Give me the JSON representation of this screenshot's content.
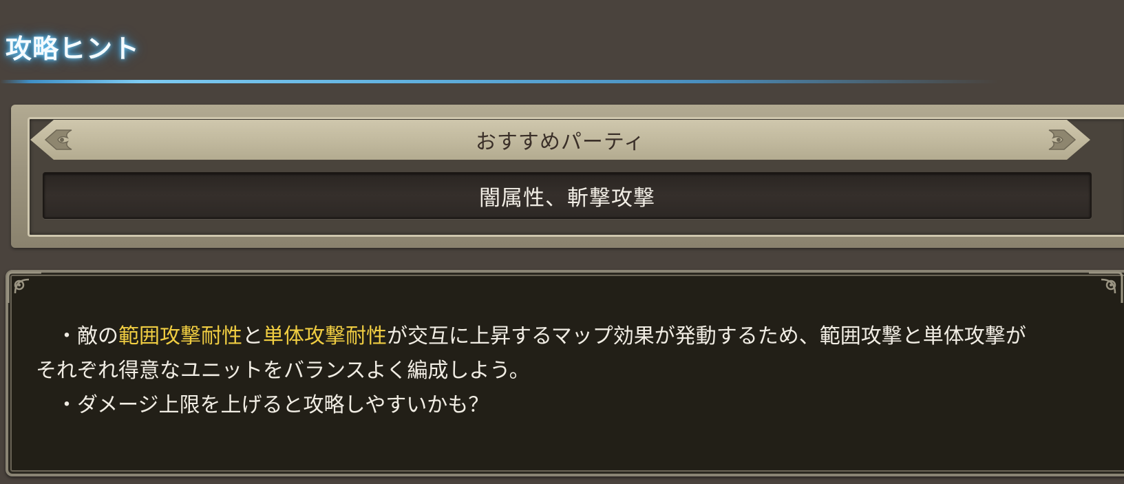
{
  "section": {
    "title": "攻略ヒント"
  },
  "party": {
    "header_label": "おすすめパーティ",
    "value": "闇属性、斬撃攻撃"
  },
  "hints": {
    "line1": {
      "prefix": "　・敵の",
      "highlight1": "範囲攻撃耐性",
      "connector": "と",
      "highlight2": "単体攻撃耐性",
      "suffix": "が交互に上昇するマップ効果が発動するため、範囲攻撃と単体攻撃が"
    },
    "line2": "それぞれ得意なユニットをバランスよく編成しよう。",
    "line3": "　・ダメージ上限を上げると攻略しやすいかも？"
  },
  "colors": {
    "background": "#4a433d",
    "title_glow": "#6fc6f2",
    "highlight": "#f0cd42",
    "panel_frame": "#b2aa92",
    "hint_background": "#221f17"
  },
  "icons": {
    "party_corner_left": "ornament-corner-icon",
    "party_corner_right": "ornament-corner-icon",
    "hint_corner_left": "scroll-ornament-icon",
    "hint_corner_right": "scroll-ornament-icon"
  }
}
